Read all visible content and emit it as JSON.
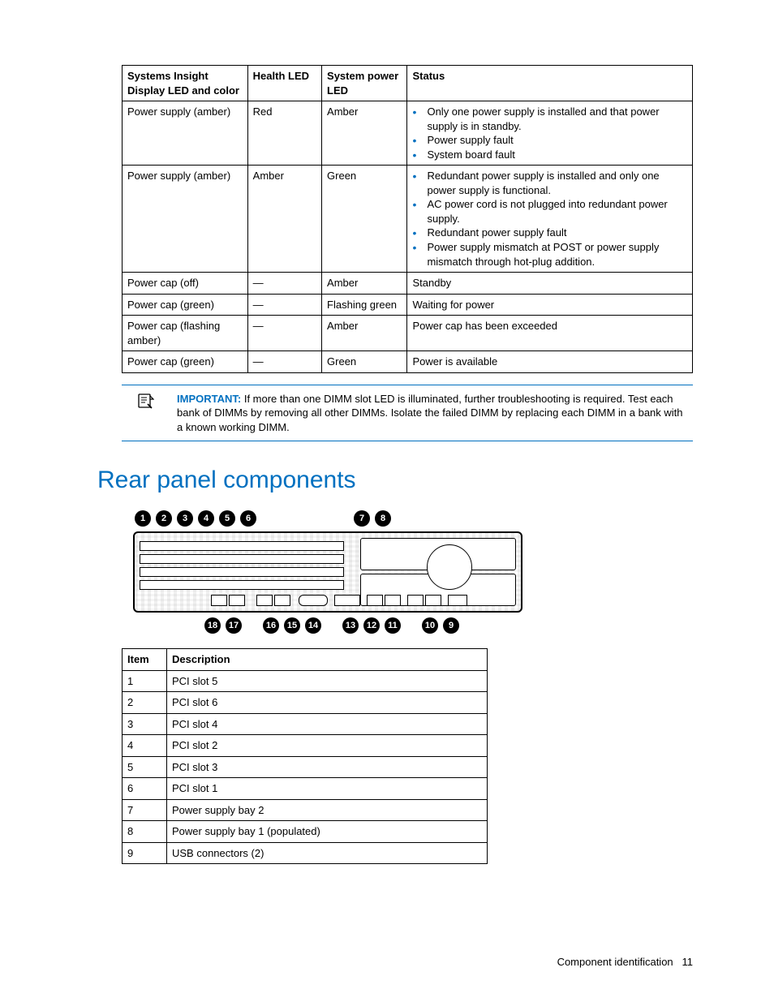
{
  "ledTable": {
    "headers": [
      "Systems Insight Display LED and color",
      "Health LED",
      "System power LED",
      "Status"
    ],
    "rows": [
      {
        "c0": "Power supply (amber)",
        "c1": "Red",
        "c2": "Amber",
        "status": [
          "Only one power supply is installed and that power supply is in standby.",
          "Power supply fault",
          "System board fault"
        ]
      },
      {
        "c0": "Power supply (amber)",
        "c1": "Amber",
        "c2": "Green",
        "status": [
          "Redundant power supply is installed and only one power supply is functional.",
          "AC power cord is not plugged into redundant power supply.",
          "Redundant power supply fault",
          "Power supply mismatch at POST or power supply mismatch through hot-plug addition."
        ]
      },
      {
        "c0": "Power cap (off)",
        "c1": "—",
        "c2": "Amber",
        "statusText": "Standby"
      },
      {
        "c0": "Power cap (green)",
        "c1": "—",
        "c2": "Flashing green",
        "statusText": "Waiting for power"
      },
      {
        "c0": "Power cap (flashing amber)",
        "c1": "—",
        "c2": "Amber",
        "statusText": "Power cap has been exceeded"
      },
      {
        "c0": "Power cap (green)",
        "c1": "—",
        "c2": "Green",
        "statusText": "Power is available"
      }
    ]
  },
  "important": {
    "label": "IMPORTANT:",
    "text": "If more than one DIMM slot LED is illuminated, further troubleshooting is required. Test each bank of DIMMs by removing all other DIMMs. Isolate the failed DIMM by replacing each DIMM in a bank with a known working DIMM."
  },
  "sectionTitle": "Rear panel components",
  "calloutsTop": [
    "1",
    "2",
    "3",
    "4",
    "5",
    "6",
    "7",
    "8"
  ],
  "calloutsBottom": [
    "18",
    "17",
    "16",
    "15",
    "14",
    "13",
    "12",
    "11",
    "10",
    "9"
  ],
  "itemsTable": {
    "headers": [
      "Item",
      "Description"
    ],
    "rows": [
      {
        "item": "1",
        "desc": "PCI slot 5"
      },
      {
        "item": "2",
        "desc": "PCI slot 6"
      },
      {
        "item": "3",
        "desc": "PCI slot 4"
      },
      {
        "item": "4",
        "desc": "PCI slot 2"
      },
      {
        "item": "5",
        "desc": "PCI slot 3"
      },
      {
        "item": "6",
        "desc": "PCI slot 1"
      },
      {
        "item": "7",
        "desc": "Power supply bay 2"
      },
      {
        "item": "8",
        "desc": "Power supply bay 1 (populated)"
      },
      {
        "item": "9",
        "desc": "USB connectors (2)"
      }
    ]
  },
  "footer": {
    "section": "Component identification",
    "page": "11"
  }
}
